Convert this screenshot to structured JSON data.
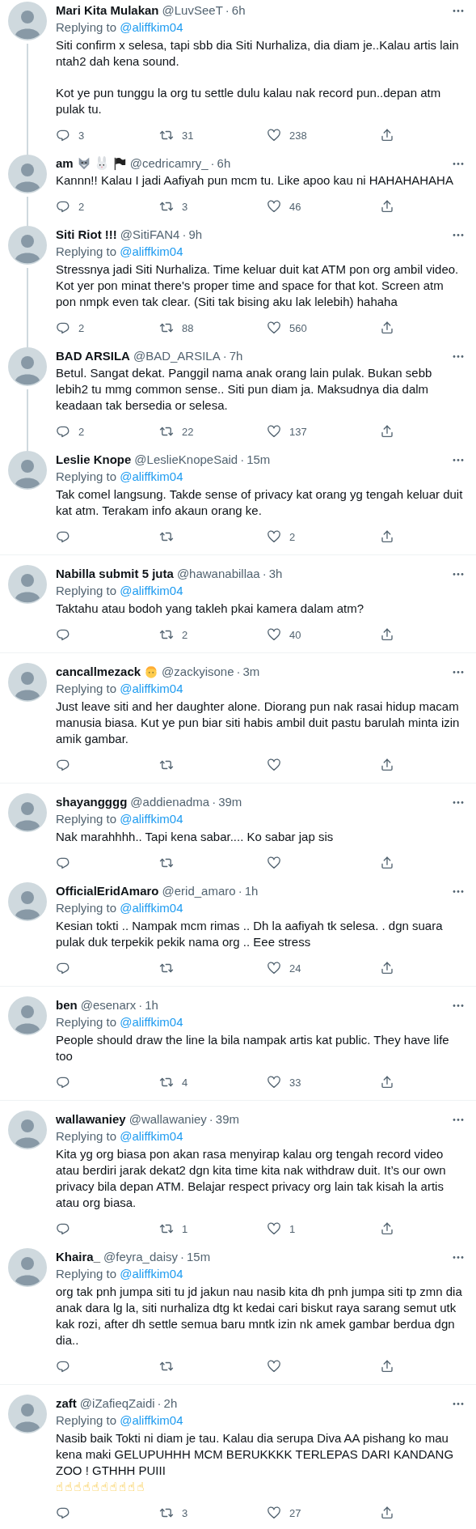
{
  "tweets": [
    {
      "name": "Mari Kita Mulakan",
      "handle": "@LuvSeeT",
      "meta_separator": "·",
      "time": "6h",
      "replying": {
        "label": "Replying to",
        "handle": "@aliffkim04"
      },
      "text": [
        "Siti confirm x selesa, tapi sbb dia Siti Nurhaliza, dia diam je..Kalau artis lain ntah2 dah kena sound.",
        "Kot ye pun tunggu la org tu settle dulu kalau nak record pun..depan atm pulak tu."
      ],
      "actions": {
        "replies": "3",
        "retweets": "31",
        "likes": "238"
      },
      "thread_line": true,
      "divider": false
    },
    {
      "name": "am",
      "name_icons": [
        {
          "kind": "wolf"
        },
        {
          "kind": "rabbit"
        },
        {
          "kind": "flag"
        }
      ],
      "handle": "@cedricamry_",
      "meta_separator": "·",
      "time": "6h",
      "text": [
        "Kannn!! Kalau I jadi Aafiyah pun mcm tu. Like apoo kau ni HAHAHAHAHA"
      ],
      "actions": {
        "replies": "2",
        "retweets": "3",
        "likes": "46"
      },
      "thread_line": true,
      "divider": false
    },
    {
      "name": "Siti Riot !!!",
      "handle": "@SitiFAN4",
      "meta_separator": "·",
      "time": "9h",
      "replying": {
        "label": "Replying to",
        "handle": "@aliffkim04"
      },
      "text": [
        "Stressnya jadi Siti Nurhaliza. Time keluar duit kat ATM pon org ambil video. Kot yer pon minat there's proper time and space for that kot. Screen atm pon nmpk even tak clear. (Siti tak bising aku lak lelebih) hahaha"
      ],
      "actions": {
        "replies": "2",
        "retweets": "88",
        "likes": "560"
      },
      "thread_line": true,
      "divider": false
    },
    {
      "name": "BAD ARSILA",
      "handle": "@BAD_ARSILA",
      "meta_separator": "·",
      "time": "7h",
      "text": [
        "Betul. Sangat dekat. Panggil nama anak orang lain pulak. Bukan sebb lebih2 tu mmg common sense.. Siti pun diam ja. Maksudnya dia dalm keadaan tak bersedia or selesa."
      ],
      "actions": {
        "replies": "2",
        "retweets": "22",
        "likes": "137"
      },
      "thread_line": true,
      "divider": false
    },
    {
      "name": "Leslie Knope",
      "handle": "@LeslieKnopeSaid",
      "meta_separator": "·",
      "time": "15m",
      "replying": {
        "label": "Replying to",
        "handle": "@aliffkim04"
      },
      "text": [
        "Tak comel langsung. Takde sense of privacy kat orang yg tengah keluar duit kat atm. Terakam info akaun orang ke."
      ],
      "actions": {
        "likes": "2"
      },
      "thread_line": false,
      "divider": true
    },
    {
      "name": "Nabilla submit 5 juta",
      "handle": "@hawanabillaa",
      "meta_separator": "·",
      "time": "3h",
      "replying": {
        "label": "Replying to",
        "handle": "@aliffkim04"
      },
      "text": [
        "Taktahu atau bodoh yang takleh pkai kamera dalam atm?"
      ],
      "actions": {
        "retweets": "2",
        "likes": "40"
      },
      "thread_line": false,
      "divider": true
    },
    {
      "name": "cancallmezack",
      "name_icons": [
        {
          "kind": "face"
        }
      ],
      "handle": "@zackyisone",
      "meta_separator": "·",
      "time": "3m",
      "replying": {
        "label": "Replying to",
        "handle": "@aliffkim04"
      },
      "text": [
        "Just leave siti and her daughter alone. Diorang pun nak rasai hidup macam manusia biasa. Kut ye pun biar siti habis ambil duit pastu barulah minta izin amik gambar."
      ],
      "thread_line": false,
      "divider": true
    },
    {
      "name": "shayangggg",
      "handle": "@addienadma",
      "meta_separator": "·",
      "time": "39m",
      "replying": {
        "label": "Replying to",
        "handle": "@aliffkim04"
      },
      "text": [
        "Nak marahhhh.. Tapi kena sabar.... Ko sabar jap sis"
      ],
      "thread_line": false,
      "divider": false
    },
    {
      "name": "OfficialEridAmaro",
      "handle": "@erid_amaro",
      "meta_separator": "·",
      "time": "1h",
      "replying": {
        "label": "Replying to",
        "handle": "@aliffkim04"
      },
      "text": [
        "Kesian tokti .. Nampak mcm rimas .. Dh la aafiyah tk selesa. . dgn suara pulak duk terpekik pekik nama org .. Eee stress"
      ],
      "actions": {
        "likes": "24"
      },
      "thread_line": false,
      "divider": true
    },
    {
      "name": "ben",
      "handle": "@esenarx",
      "meta_separator": "·",
      "time": "1h",
      "replying": {
        "label": "Replying to",
        "handle": "@aliffkim04"
      },
      "text": [
        "People should draw the line la bila nampak artis kat public. They have life too"
      ],
      "actions": {
        "retweets": "4",
        "likes": "33"
      },
      "thread_line": false,
      "divider": true
    },
    {
      "name": "wallawaniey",
      "handle": "@wallawaniey",
      "meta_separator": "·",
      "time": "39m",
      "replying": {
        "label": "Replying to",
        "handle": "@aliffkim04"
      },
      "text": [
        "Kita yg org biasa pon akan rasa menyirap kalau org tengah record video atau berdiri jarak dekat2 dgn kita time kita nak withdraw duit. It’s our own privacy bila depan ATM. Belajar respect privacy org lain tak kisah la artis atau org biasa."
      ],
      "actions": {
        "retweets": "1",
        "likes": "1"
      },
      "thread_line": false,
      "divider": false
    },
    {
      "name": "Khaira_",
      "handle": "@feyra_daisy",
      "meta_separator": "·",
      "time": "15m",
      "replying": {
        "label": "Replying to",
        "handle": "@aliffkim04"
      },
      "text": [
        "org tak pnh jumpa siti tu jd jakun nau nasib kita dh pnh jumpa siti tp zmn dia anak dara lg la, siti nurhaliza dtg kt kedai cari biskut raya sarang semut utk kak rozi, after dh settle semua baru mntk izin nk amek gambar berdua dgn dia.."
      ],
      "thread_line": false,
      "divider": true
    },
    {
      "name": "zaft",
      "handle": "@iZafieqZaidi",
      "meta_separator": "·",
      "time": "2h",
      "replying": {
        "label": "Replying to",
        "handle": "@aliffkim04"
      },
      "text": [
        "Nasib baik Tokti ni diam je tau. Kalau dia serupa Diva AA pishang ko mau kena maki GELUPUHHH MCM BERUKKKK TERLEPAS DARI KANDANG ZOO ! GTHHH PUIII"
      ],
      "trailing_emoji": "☝☝☝☝☝☝☝☝☝☝",
      "actions": {
        "retweets": "3",
        "likes": "27"
      },
      "thread_line": false,
      "divider": false
    }
  ]
}
